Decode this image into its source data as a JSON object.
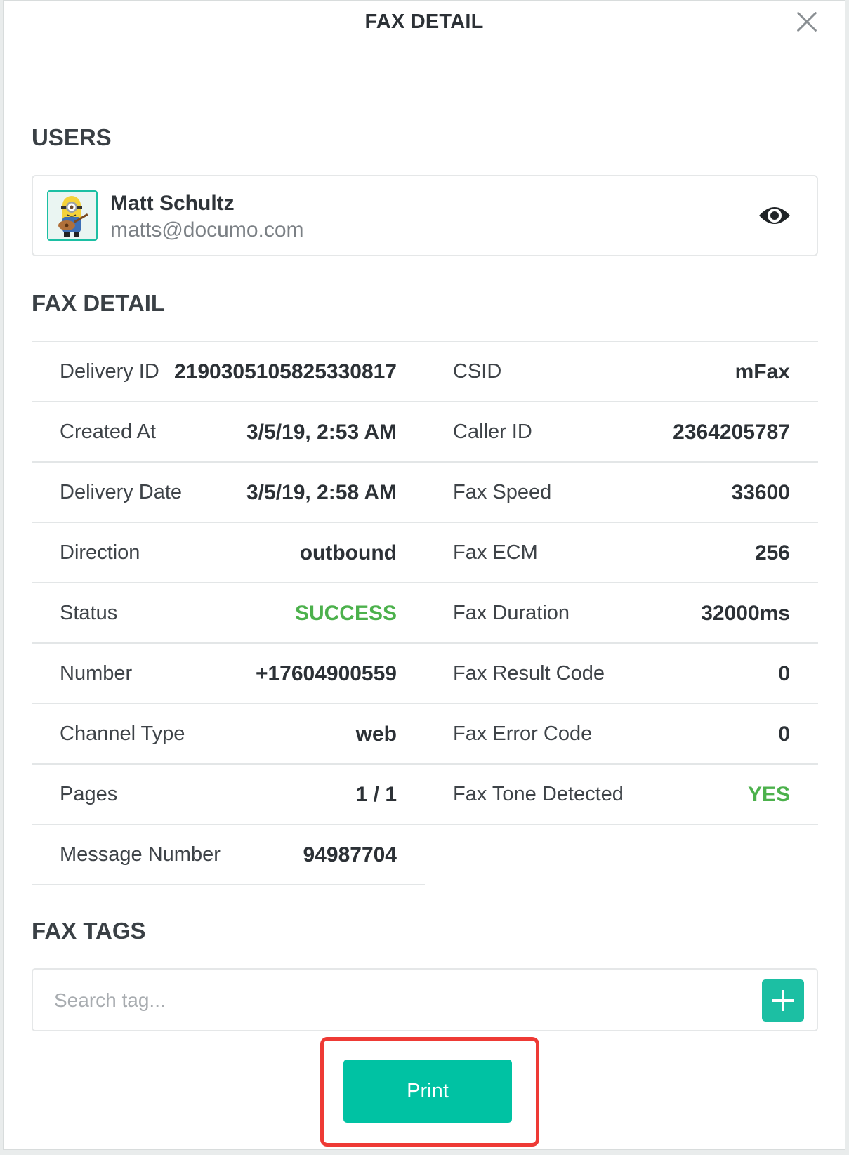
{
  "modal": {
    "title": "FAX DETAIL"
  },
  "users": {
    "section_title": "USERS",
    "user": {
      "name": "Matt Schultz",
      "email": "matts@documo.com"
    }
  },
  "fax_detail": {
    "section_title": "FAX DETAIL",
    "rows": [
      {
        "left_label": "Delivery ID",
        "left_value": "21903051058253308​17",
        "right_label": "CSID",
        "right_value": "mFax"
      },
      {
        "left_label": "Created At",
        "left_value": "3/5/19, 2:53 AM",
        "right_label": "Caller ID",
        "right_value": "2364205787"
      },
      {
        "left_label": "Delivery Date",
        "left_value": "3/5/19, 2:58 AM",
        "right_label": "Fax Speed",
        "right_value": "33600"
      },
      {
        "left_label": "Direction",
        "left_value": "outbound",
        "right_label": "Fax ECM",
        "right_value": "256"
      },
      {
        "left_label": "Status",
        "left_value": "SUCCESS",
        "right_label": "Fax Duration",
        "right_value": "32000ms"
      },
      {
        "left_label": "Number",
        "left_value": "+17604900559",
        "right_label": "Fax Result Code",
        "right_value": "0"
      },
      {
        "left_label": "Channel Type",
        "left_value": "web",
        "right_label": "Fax Error Code",
        "right_value": "0"
      },
      {
        "left_label": "Pages",
        "left_value": "1 / 1",
        "right_label": "Fax Tone Detected",
        "right_value": "YES"
      },
      {
        "left_label": "Message Number",
        "left_value": "94987704"
      }
    ]
  },
  "fax_tags": {
    "section_title": "FAX TAGS",
    "search_placeholder": "Search tag..."
  },
  "actions": {
    "print_label": "Print"
  },
  "colors": {
    "accent": "#00c2a3",
    "success": "#4cb14c",
    "highlight": "#ee3a35"
  }
}
